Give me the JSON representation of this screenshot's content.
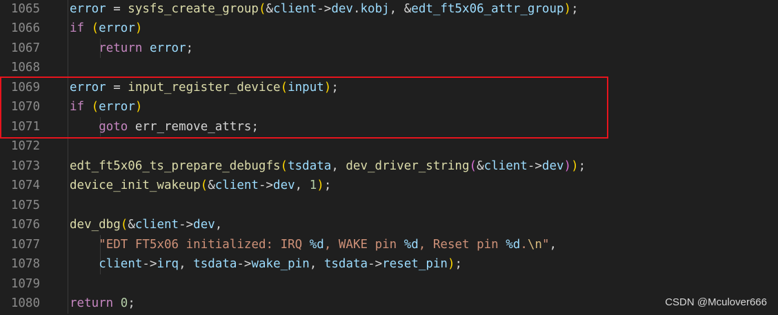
{
  "colors": {
    "background": "#1f1f1f",
    "line_number": "#8b8b8b",
    "highlight_box": "#e8141d"
  },
  "watermark": "CSDN @Mculover666",
  "lines": [
    {
      "num": "1065",
      "indent": 1,
      "tokens": [
        {
          "t": "error",
          "c": "var"
        },
        {
          "t": " = ",
          "c": "pl"
        },
        {
          "t": "sysfs_create_group",
          "c": "fn"
        },
        {
          "t": "(",
          "c": "b1"
        },
        {
          "t": "&",
          "c": "pl"
        },
        {
          "t": "client",
          "c": "var"
        },
        {
          "t": "->",
          "c": "pl"
        },
        {
          "t": "dev",
          "c": "var"
        },
        {
          "t": ".",
          "c": "pl"
        },
        {
          "t": "kobj",
          "c": "var"
        },
        {
          "t": ", ",
          "c": "pl"
        },
        {
          "t": "&",
          "c": "pl"
        },
        {
          "t": "edt_ft5x06_attr_group",
          "c": "var"
        },
        {
          "t": ")",
          "c": "b1"
        },
        {
          "t": ";",
          "c": "pl"
        }
      ]
    },
    {
      "num": "1066",
      "indent": 1,
      "tokens": [
        {
          "t": "if",
          "c": "kw"
        },
        {
          "t": " ",
          "c": "pl"
        },
        {
          "t": "(",
          "c": "b1"
        },
        {
          "t": "error",
          "c": "var"
        },
        {
          "t": ")",
          "c": "b1"
        }
      ]
    },
    {
      "num": "1067",
      "indent": 2,
      "tokens": [
        {
          "t": "return",
          "c": "kw"
        },
        {
          "t": " ",
          "c": "pl"
        },
        {
          "t": "error",
          "c": "var"
        },
        {
          "t": ";",
          "c": "pl"
        }
      ]
    },
    {
      "num": "1068",
      "indent": 1,
      "tokens": []
    },
    {
      "num": "1069",
      "indent": 1,
      "tokens": [
        {
          "t": "error",
          "c": "var"
        },
        {
          "t": " = ",
          "c": "pl"
        },
        {
          "t": "input_register_device",
          "c": "fn"
        },
        {
          "t": "(",
          "c": "b1"
        },
        {
          "t": "input",
          "c": "var"
        },
        {
          "t": ")",
          "c": "b1"
        },
        {
          "t": ";",
          "c": "pl"
        }
      ]
    },
    {
      "num": "1070",
      "indent": 1,
      "tokens": [
        {
          "t": "if",
          "c": "kw"
        },
        {
          "t": " ",
          "c": "pl"
        },
        {
          "t": "(",
          "c": "b1"
        },
        {
          "t": "error",
          "c": "var"
        },
        {
          "t": ")",
          "c": "b1"
        }
      ]
    },
    {
      "num": "1071",
      "indent": 2,
      "tokens": [
        {
          "t": "goto",
          "c": "kw"
        },
        {
          "t": " err_remove_attrs;",
          "c": "pl"
        }
      ]
    },
    {
      "num": "1072",
      "indent": 1,
      "tokens": []
    },
    {
      "num": "1073",
      "indent": 1,
      "tokens": [
        {
          "t": "edt_ft5x06_ts_prepare_debugfs",
          "c": "fn"
        },
        {
          "t": "(",
          "c": "b1"
        },
        {
          "t": "tsdata",
          "c": "var"
        },
        {
          "t": ", ",
          "c": "pl"
        },
        {
          "t": "dev_driver_string",
          "c": "fn"
        },
        {
          "t": "(",
          "c": "b2"
        },
        {
          "t": "&",
          "c": "pl"
        },
        {
          "t": "client",
          "c": "var"
        },
        {
          "t": "->",
          "c": "pl"
        },
        {
          "t": "dev",
          "c": "var"
        },
        {
          "t": ")",
          "c": "b2"
        },
        {
          "t": ")",
          "c": "b1"
        },
        {
          "t": ";",
          "c": "pl"
        }
      ]
    },
    {
      "num": "1074",
      "indent": 1,
      "tokens": [
        {
          "t": "device_init_wakeup",
          "c": "fn"
        },
        {
          "t": "(",
          "c": "b1"
        },
        {
          "t": "&",
          "c": "pl"
        },
        {
          "t": "client",
          "c": "var"
        },
        {
          "t": "->",
          "c": "pl"
        },
        {
          "t": "dev",
          "c": "var"
        },
        {
          "t": ", ",
          "c": "pl"
        },
        {
          "t": "1",
          "c": "num"
        },
        {
          "t": ")",
          "c": "b1"
        },
        {
          "t": ";",
          "c": "pl"
        }
      ]
    },
    {
      "num": "1075",
      "indent": 1,
      "tokens": []
    },
    {
      "num": "1076",
      "indent": 1,
      "tokens": [
        {
          "t": "dev_dbg",
          "c": "fn"
        },
        {
          "t": "(",
          "c": "b1"
        },
        {
          "t": "&",
          "c": "pl"
        },
        {
          "t": "client",
          "c": "var"
        },
        {
          "t": "->",
          "c": "pl"
        },
        {
          "t": "dev",
          "c": "var"
        },
        {
          "t": ",",
          "c": "pl"
        }
      ]
    },
    {
      "num": "1077",
      "indent": 2,
      "tokens": [
        {
          "t": "\"EDT FT5x06 initialized: IRQ ",
          "c": "str"
        },
        {
          "t": "%d",
          "c": "var"
        },
        {
          "t": ", WAKE pin ",
          "c": "str"
        },
        {
          "t": "%d",
          "c": "var"
        },
        {
          "t": ", Reset pin ",
          "c": "str"
        },
        {
          "t": "%d",
          "c": "var"
        },
        {
          "t": ".",
          "c": "str"
        },
        {
          "t": "\\n",
          "c": "esc"
        },
        {
          "t": "\"",
          "c": "str"
        },
        {
          "t": ",",
          "c": "pl"
        }
      ]
    },
    {
      "num": "1078",
      "indent": 2,
      "tokens": [
        {
          "t": "client",
          "c": "var"
        },
        {
          "t": "->",
          "c": "pl"
        },
        {
          "t": "irq",
          "c": "var"
        },
        {
          "t": ", ",
          "c": "pl"
        },
        {
          "t": "tsdata",
          "c": "var"
        },
        {
          "t": "->",
          "c": "pl"
        },
        {
          "t": "wake_pin",
          "c": "var"
        },
        {
          "t": ", ",
          "c": "pl"
        },
        {
          "t": "tsdata",
          "c": "var"
        },
        {
          "t": "->",
          "c": "pl"
        },
        {
          "t": "reset_pin",
          "c": "var"
        },
        {
          "t": ")",
          "c": "b1"
        },
        {
          "t": ";",
          "c": "pl"
        }
      ]
    },
    {
      "num": "1079",
      "indent": 1,
      "tokens": []
    },
    {
      "num": "1080",
      "indent": 1,
      "tokens": [
        {
          "t": "return",
          "c": "kw"
        },
        {
          "t": " ",
          "c": "pl"
        },
        {
          "t": "0",
          "c": "num"
        },
        {
          "t": ";",
          "c": "pl"
        }
      ]
    }
  ]
}
